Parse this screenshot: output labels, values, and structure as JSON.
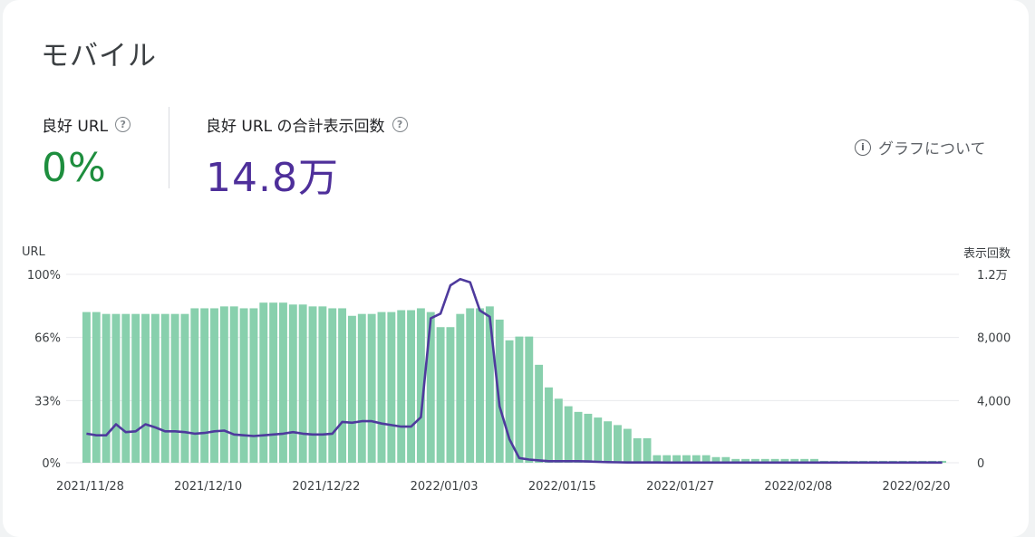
{
  "title": "モバイル",
  "metrics": {
    "good_url": {
      "label": "良好 URL",
      "value": "0%"
    },
    "impressions": {
      "label": "良好 URL の合計表示回数",
      "value": "14.8万"
    }
  },
  "about_graph_label": "グラフについて",
  "colors": {
    "bars": "#88d0ad",
    "line": "#4e3a9d",
    "good": "#1e8e3e",
    "impressions": "#4e2f9a"
  },
  "chart_data": {
    "type": "bar",
    "left_axis_label": "URL",
    "right_axis_label": "表示回数",
    "left_ticks": [
      "0%",
      "33%",
      "66%",
      "100%"
    ],
    "right_ticks": [
      "0",
      "4,000",
      "8,000",
      "1.2万"
    ],
    "x_tick_labels": [
      "2021/11/28",
      "2021/12/10",
      "2021/12/22",
      "2022/01/03",
      "2022/01/15",
      "2022/01/27",
      "2022/02/08",
      "2022/02/20"
    ],
    "date_range": {
      "start": "2021/11/28",
      "end": "2022/02/22"
    },
    "ylim_left": [
      0,
      100
    ],
    "ylim_right": [
      0,
      12000
    ],
    "grid": true,
    "series": [
      {
        "type": "bar",
        "axis": "left",
        "values": [
          80,
          80,
          79,
          79,
          79,
          79,
          79,
          79,
          79,
          79,
          79,
          82,
          82,
          82,
          83,
          83,
          82,
          82,
          85,
          85,
          85,
          84,
          84,
          83,
          83,
          82,
          82,
          78,
          79,
          79,
          80,
          80,
          81,
          81,
          82,
          80,
          72,
          72,
          79,
          82,
          82,
          83,
          76,
          65,
          67,
          67,
          52,
          40,
          34,
          30,
          27,
          26,
          24,
          22,
          20,
          18,
          13,
          13,
          4,
          4,
          4,
          4,
          4,
          4,
          3,
          3,
          2,
          2,
          2,
          2,
          2,
          2,
          2,
          2,
          2,
          1,
          1,
          1,
          1,
          1,
          1,
          1,
          1,
          1,
          1,
          1,
          1,
          1
        ]
      },
      {
        "type": "line",
        "axis": "right",
        "values": [
          1850,
          1750,
          1750,
          2450,
          1950,
          2000,
          2450,
          2250,
          2000,
          2000,
          1950,
          1850,
          1900,
          2000,
          2050,
          1800,
          1750,
          1700,
          1750,
          1800,
          1850,
          1950,
          1850,
          1800,
          1800,
          1850,
          2600,
          2550,
          2650,
          2650,
          2500,
          2400,
          2300,
          2300,
          2900,
          9200,
          9500,
          11300,
          11700,
          11500,
          9700,
          9300,
          3600,
          1500,
          300,
          200,
          150,
          100,
          100,
          100,
          100,
          80,
          60,
          40,
          30,
          20,
          20,
          20,
          20,
          10,
          10,
          10,
          10,
          10,
          10,
          10,
          10,
          10,
          10,
          10,
          10,
          10,
          10,
          10,
          10,
          10,
          10,
          10,
          10,
          10,
          10,
          10,
          10,
          10,
          10,
          10,
          10,
          10
        ]
      }
    ]
  }
}
